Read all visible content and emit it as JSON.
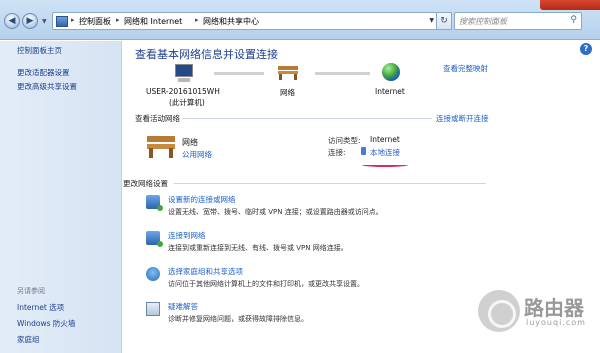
{
  "address": {
    "crumbs": [
      "控制面板",
      "网络和 Internet",
      "网络和共享中心"
    ],
    "search_placeholder": "搜索控制面板"
  },
  "left_pane": {
    "items": [
      "控制面板主页",
      "更改适配器设置",
      "更改高级共享设置"
    ],
    "see_also_title": "另请参阅",
    "see_also": [
      "Internet 选项",
      "Windows 防火墙",
      "家庭组"
    ]
  },
  "main": {
    "title": "查看基本网络信息并设置连接",
    "full_map": "查看完整映射",
    "map": {
      "computer_line1": "USER-20161015WH",
      "computer_line2": "(此计算机)",
      "network": "网络",
      "internet": "Internet"
    },
    "active_title": "查看活动网络",
    "connect_disconnect": "连接或断开连接",
    "network_name": "网络",
    "network_type": "公用网络",
    "access_type_label": "访问类型:",
    "access_type_value": "Internet",
    "connection_label": "连接:",
    "connection_value": "本地连接",
    "change_title": "更改网络设置",
    "tasks": [
      {
        "title": "设置新的连接或网络",
        "desc": "设置无线、宽带、拨号、临时或 VPN 连接；或设置路由器或访问点。",
        "icon": "network-setup-icon"
      },
      {
        "title": "连接到网络",
        "desc": "连接到或重新连接到无线、有线、拨号或 VPN 网络连接。",
        "icon": "connect-network-icon"
      },
      {
        "title": "选择家庭组和共享选项",
        "desc": "访问位于其他网络计算机上的文件和打印机，或更改共享设置。",
        "icon": "homegroup-icon"
      },
      {
        "title": "疑难解答",
        "desc": "诊断并修复网络问题，或获得故障排除信息。",
        "icon": "troubleshoot-icon"
      }
    ]
  },
  "watermark": {
    "text": "路由器",
    "sub": "luyouqi.com"
  }
}
